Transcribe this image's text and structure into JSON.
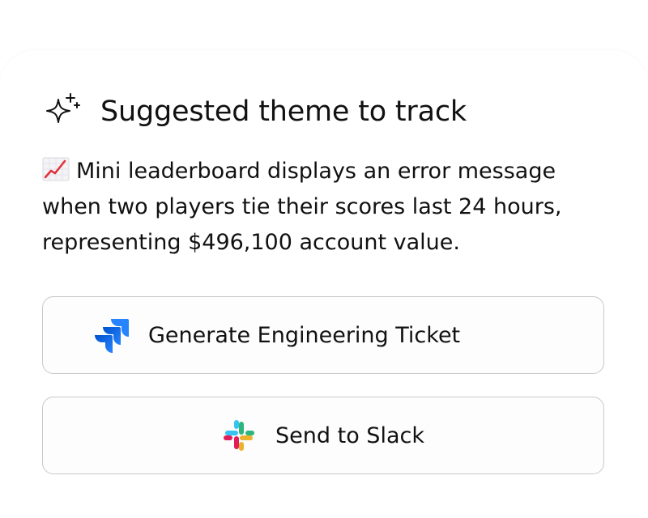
{
  "card": {
    "icon": "sparkle-icon",
    "title": "Suggested theme to track",
    "message_icon": "chart-increasing-emoji",
    "message": "Mini leaderboard displays an error message when two players tie their scores last 24 hours, representing $496,100 account value."
  },
  "actions": [
    {
      "label": "Generate Engineering Ticket",
      "icon": "jira-icon",
      "icon_color": "#2684FF"
    },
    {
      "label": "Send to Slack",
      "icon": "slack-icon",
      "icon_colors": [
        "#36C5F0",
        "#2EB67D",
        "#ECB22E",
        "#E01E5A"
      ]
    }
  ]
}
